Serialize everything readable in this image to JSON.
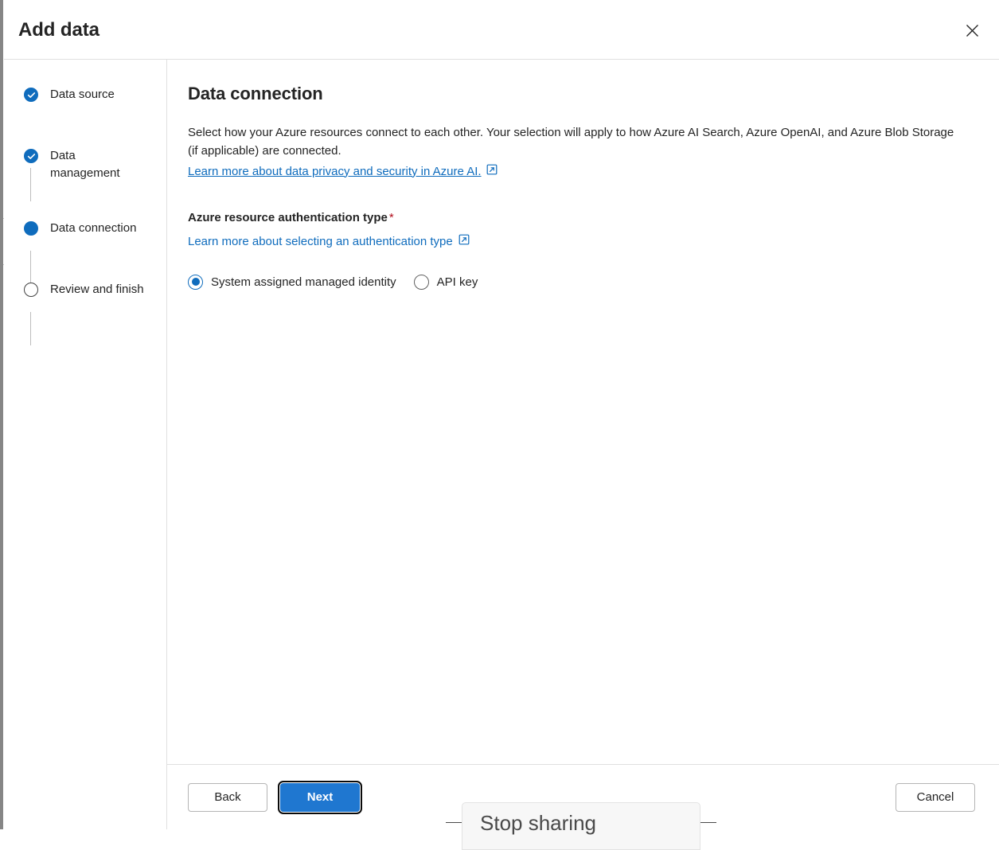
{
  "dialog": {
    "title": "Add data",
    "close_icon": "close-icon"
  },
  "wizard": {
    "steps": [
      {
        "label": "Data source",
        "state": "done"
      },
      {
        "label": "Data management",
        "state": "done"
      },
      {
        "label": "Data connection",
        "state": "current"
      },
      {
        "label": "Review and finish",
        "state": "pending"
      }
    ]
  },
  "main": {
    "heading": "Data connection",
    "description": "Select how your Azure resources connect to each other. Your selection will apply to how Azure AI Search, Azure OpenAI, and Azure Blob Storage (if applicable) are connected.",
    "privacy_link": "Learn more about data privacy and security in Azure AI.",
    "auth_label": "Azure resource authentication type",
    "required_mark": "*",
    "auth_link": "Learn more about selecting an authentication type",
    "auth_options": [
      {
        "label": "System assigned managed identity",
        "selected": true
      },
      {
        "label": "API key",
        "selected": false
      }
    ]
  },
  "footer": {
    "back_label": "Back",
    "next_label": "Next",
    "cancel_label": "Cancel"
  },
  "overlay": {
    "share_toast_text": "Stop sharing"
  },
  "colors": {
    "accent": "#0f6cbd",
    "primary_button": "#1f77d0",
    "required_red": "#b10e1c",
    "divider": "#e0e0e0"
  }
}
